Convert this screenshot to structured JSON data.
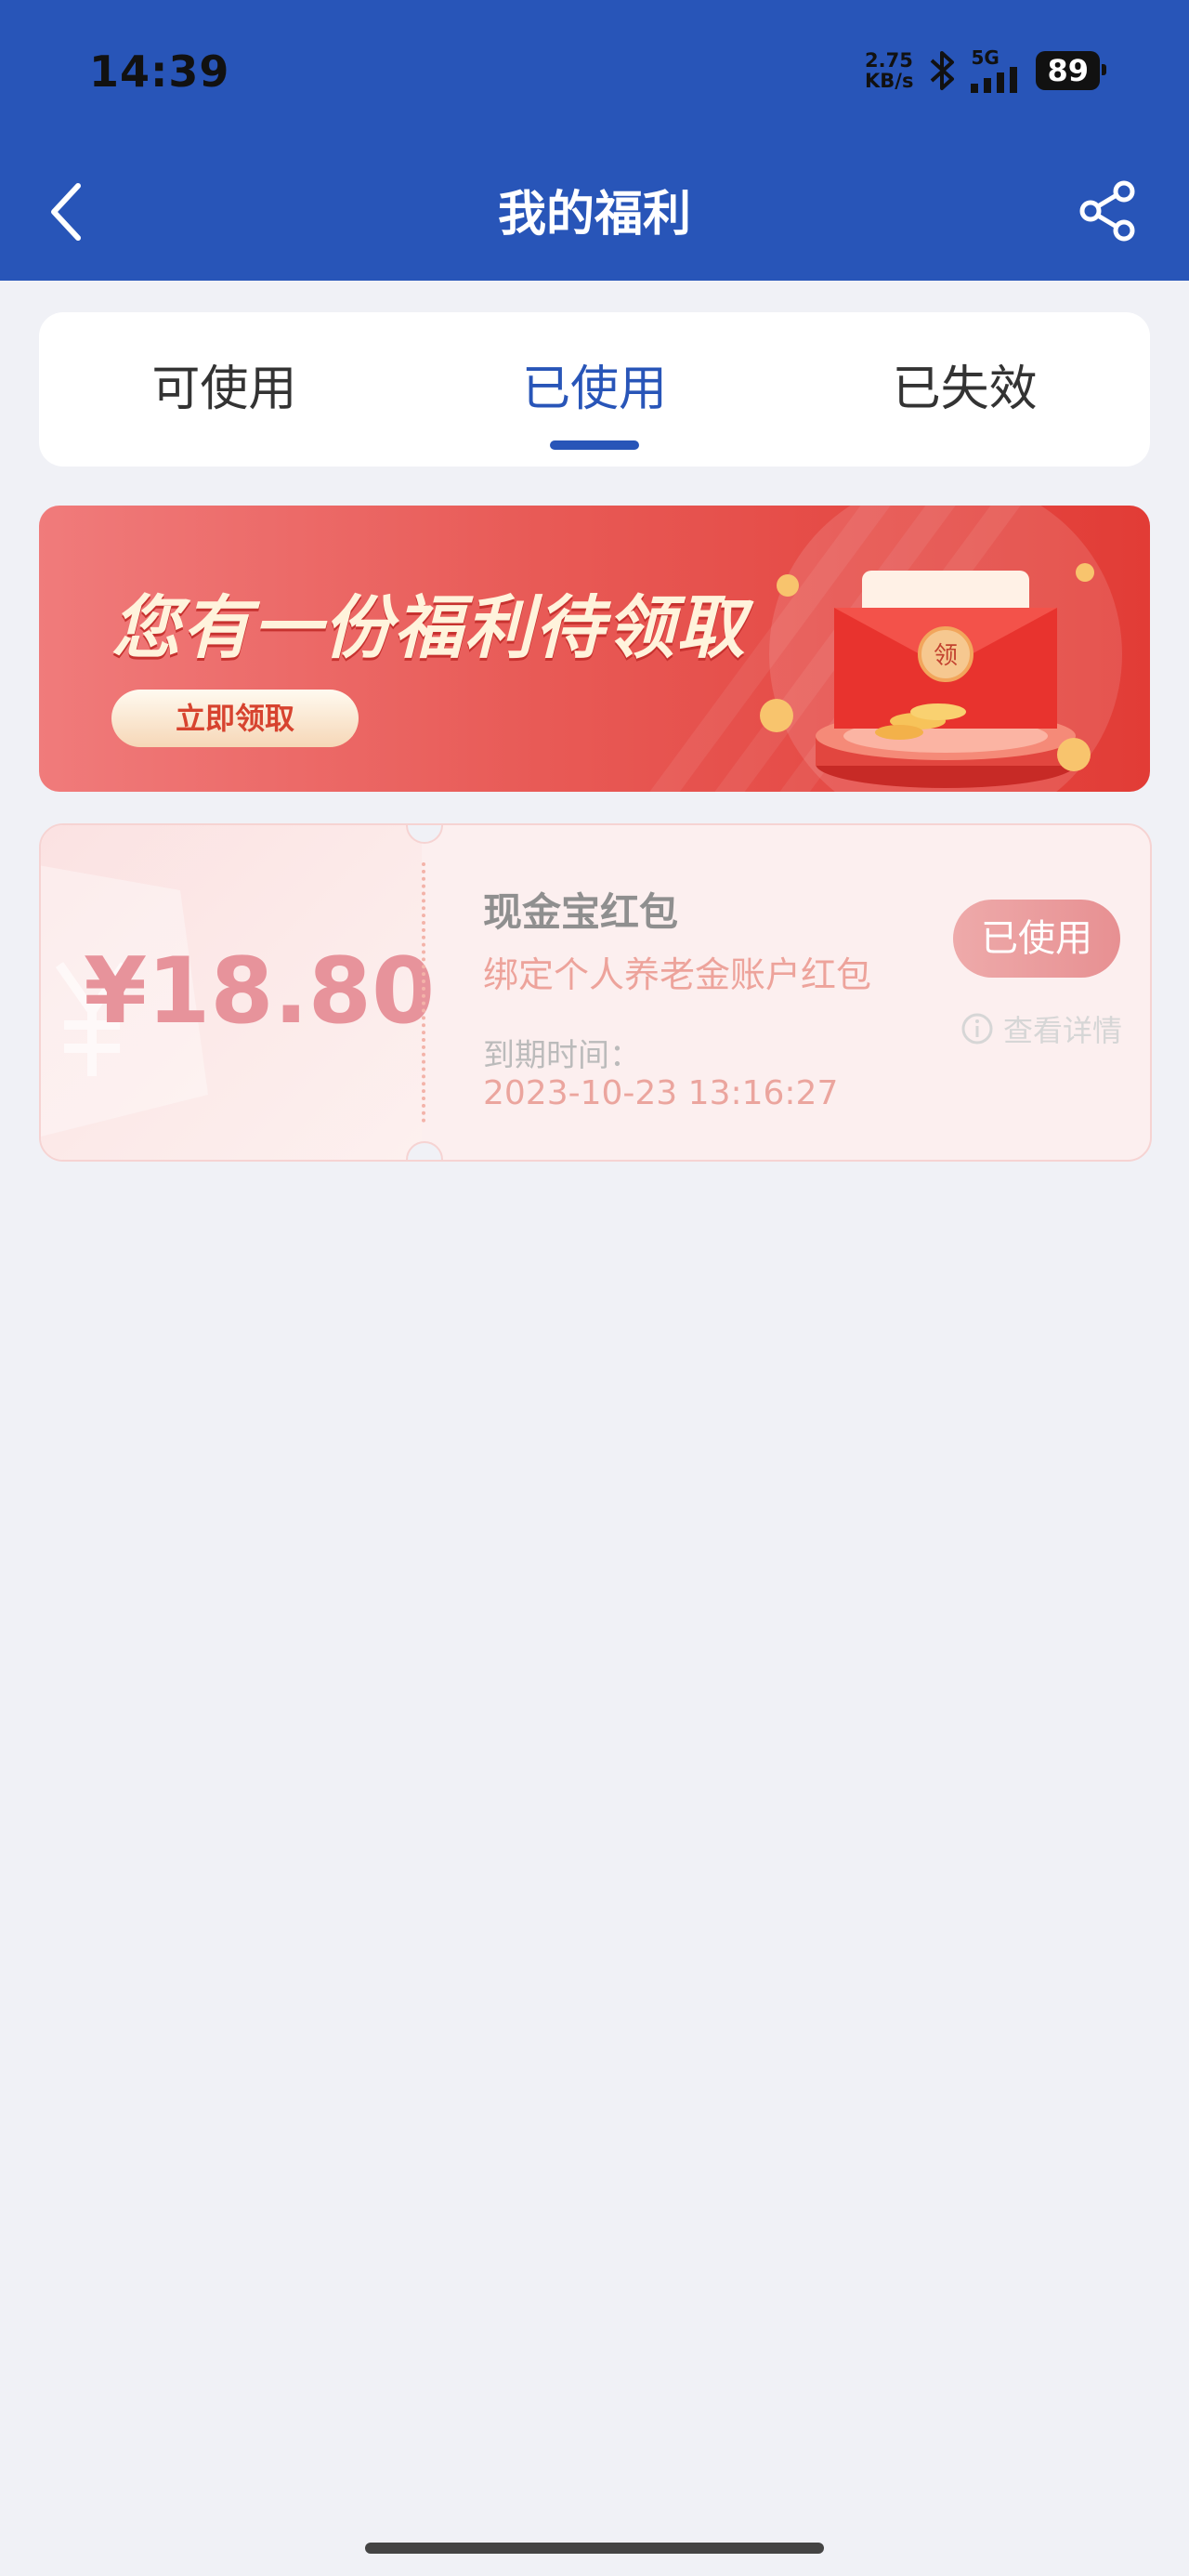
{
  "status_bar": {
    "time": "14:39",
    "net_speed_value": "2.75",
    "net_speed_unit": "KB/s",
    "network": "5G",
    "battery": "89",
    "icons": [
      "bluetooth-icon",
      "signal-icon",
      "battery-icon"
    ]
  },
  "header": {
    "title": "我的福利",
    "back_icon": "chevron-left-icon",
    "share_icon": "share-icon",
    "bg_color": "#2855b8"
  },
  "tabs": [
    {
      "label": "可使用",
      "active": false
    },
    {
      "label": "已使用",
      "active": true
    },
    {
      "label": "已失效",
      "active": false
    }
  ],
  "banner": {
    "headline": "您有一份福利待领取",
    "button_label": "立即领取",
    "envelope_text": "领"
  },
  "coupon": {
    "amount": "¥18.80",
    "title": "现金宝红包",
    "description": "绑定个人养老金账户红包",
    "expiry_label": "到期时间：",
    "expiry_value": "2023-10-23 13:16:27",
    "status_label": "已使用",
    "detail_label": "查看详情",
    "accent_color": "#e7939b"
  }
}
